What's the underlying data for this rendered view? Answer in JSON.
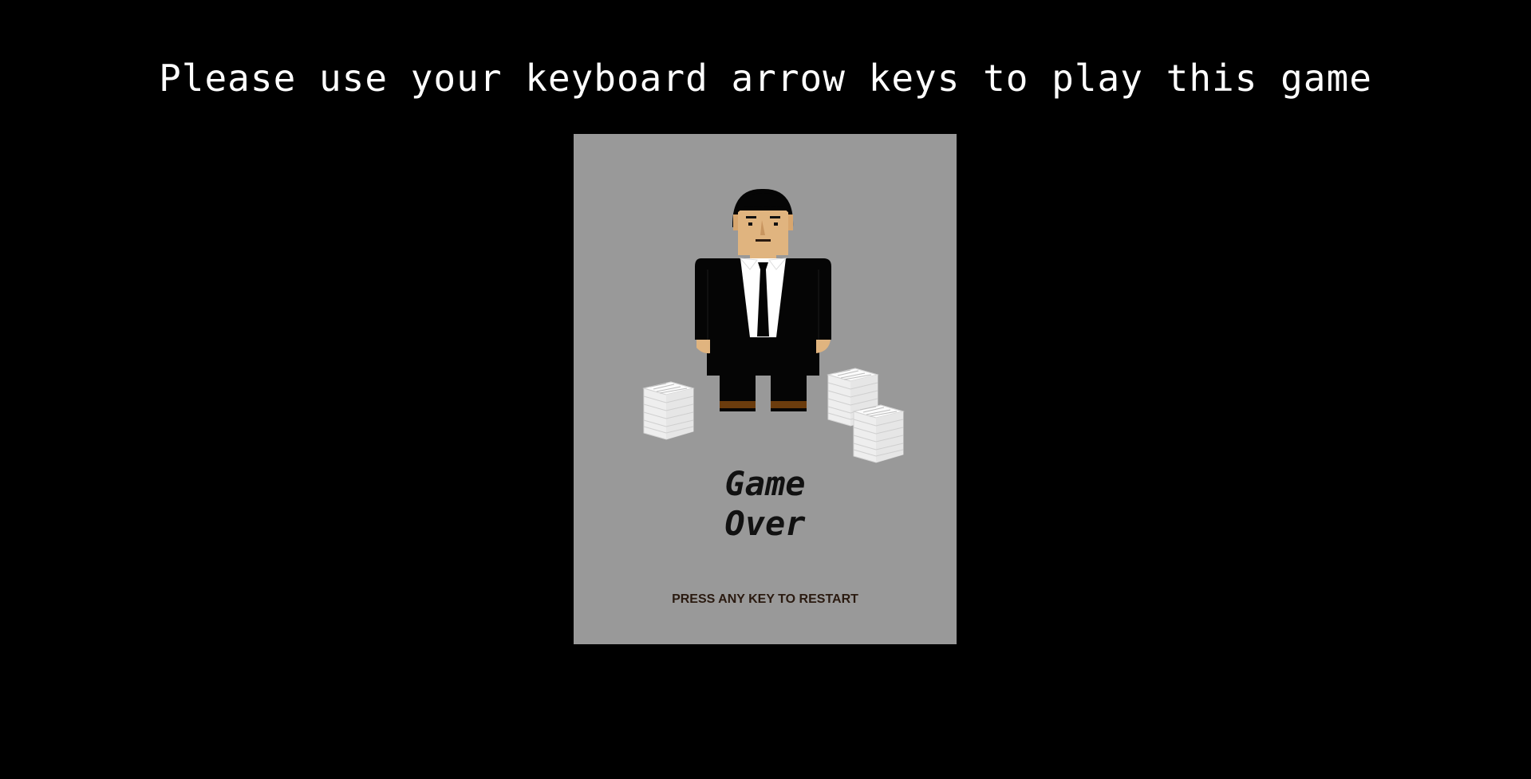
{
  "page": {
    "instructions": "Please use your keyboard arrow keys to play this game",
    "background_color": "#000000"
  },
  "game": {
    "board_color": "#999999",
    "title_line1": "Game",
    "title_line2": "Over",
    "restart_hint": "PRESS ANY KEY TO RESTART",
    "sprites": {
      "player": "businessman-sprite",
      "obstacles": [
        "paper-stack-sprite",
        "paper-stack-sprite",
        "paper-stack-sprite"
      ]
    },
    "colors": {
      "suit": "#050505",
      "skin": "#e0b47f",
      "shirt": "#ffffff",
      "shoes": "#6b3c0d",
      "paper": "#f2f2f2"
    }
  }
}
